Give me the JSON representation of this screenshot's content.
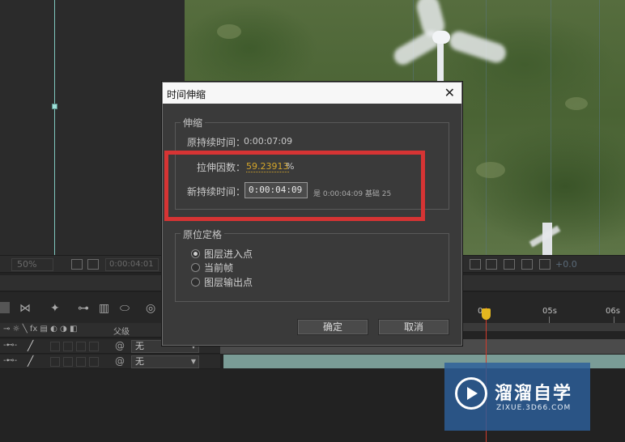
{
  "viewer": {
    "zoom": "50%",
    "timecode": "0:00:04:01",
    "exposure": "+0.0"
  },
  "timeline": {
    "parent_header": "父级",
    "layers": [
      {
        "parent": "无"
      },
      {
        "parent": "无"
      }
    ],
    "ruler": [
      "0s",
      "05s",
      "06s"
    ]
  },
  "dialog": {
    "title": "时间伸缩",
    "close_glyph": "✕",
    "stretch_group": {
      "label": "伸缩",
      "original_duration_label": "原持续时间：",
      "original_duration_value": "0:00:07:09",
      "stretch_factor_label": "拉伸因数：",
      "stretch_factor_value": "59.23913",
      "stretch_factor_unit": "%",
      "new_duration_label": "新持续时间：",
      "new_duration_value": "0:00:04:09",
      "new_duration_info": "是 0:00:04:09  基础 25"
    },
    "hold_group": {
      "label": "原位定格",
      "options": [
        {
          "label": "图层进入点",
          "selected": true
        },
        {
          "label": "当前帧",
          "selected": false
        },
        {
          "label": "图层输出点",
          "selected": false
        }
      ]
    },
    "ok_label": "确定",
    "cancel_label": "取消"
  },
  "watermark": {
    "title": "溜溜自学",
    "subtitle": "ZIXUE.3D66.COM"
  },
  "colors": {
    "highlight": "#d63434",
    "stretch_value": "#d5a62a",
    "watermark_bg": "#2c5f9b",
    "playhead": "#d23b2c"
  }
}
